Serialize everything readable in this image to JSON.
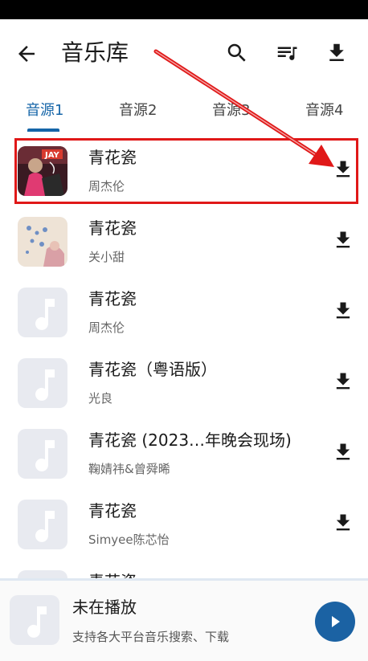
{
  "appbar": {
    "title": "音乐库",
    "icons": [
      "back-arrow-icon",
      "search-icon",
      "playlist-icon",
      "download-icon"
    ]
  },
  "tabs": [
    {
      "label": "音源1",
      "active": true
    },
    {
      "label": "音源2",
      "active": false
    },
    {
      "label": "音源3",
      "active": false
    },
    {
      "label": "音源4",
      "active": false
    }
  ],
  "songs": [
    {
      "title": "青花瓷",
      "artist": "周杰伦",
      "cover": "album-art-jay"
    },
    {
      "title": "青花瓷",
      "artist": "关小甜",
      "cover": "album-art-blue-text"
    },
    {
      "title": "青花瓷",
      "artist": "周杰伦",
      "cover": "music-note-icon"
    },
    {
      "title": "青花瓷（粤语版）",
      "artist": "光良",
      "cover": "music-note-icon"
    },
    {
      "title": "青花瓷 (2023…年晚会现场)",
      "artist": "鞠婧祎&曾舜晞",
      "cover": "music-note-icon"
    },
    {
      "title": "青花瓷",
      "artist": "Simyee陈芯怡",
      "cover": "music-note-icon"
    },
    {
      "title": "青花瓷",
      "artist": "",
      "cover": "music-note-icon"
    }
  ],
  "player": {
    "title": "未在播放",
    "subtitle": "支持各大平台音乐搜索、下载",
    "play_icon": "play-icon"
  },
  "colors": {
    "accent": "#1565a8",
    "play_button": "#1b62a3",
    "annotation": "#e01818",
    "placeholder_cover": "#e8eaf0"
  }
}
